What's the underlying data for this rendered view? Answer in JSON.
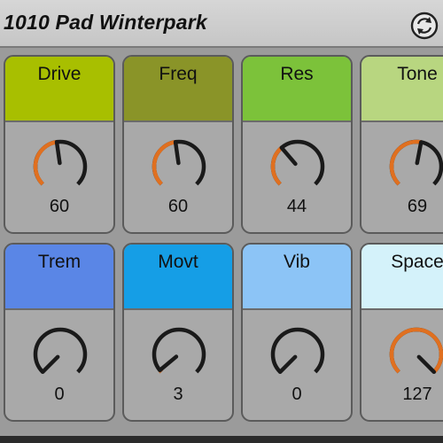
{
  "device": {
    "title": "1010 Pad Winterpark",
    "icon": "hot-swap-icon"
  },
  "macros": [
    {
      "label": "Drive",
      "value": "60",
      "level": 0.47,
      "color": "#a8bf00"
    },
    {
      "label": "Freq",
      "value": "60",
      "level": 0.47,
      "color": "#8a9428"
    },
    {
      "label": "Res",
      "value": "44",
      "level": 0.35,
      "color": "#7cc23a"
    },
    {
      "label": "Tone",
      "value": "69",
      "level": 0.54,
      "color": "#b8d680"
    },
    {
      "label": "Trem",
      "value": "0",
      "level": 0.0,
      "color": "#5a86e6"
    },
    {
      "label": "Movt",
      "value": "3",
      "level": 0.02,
      "color": "#159ee6"
    },
    {
      "label": "Vib",
      "value": "0",
      "level": 0.0,
      "color": "#8cc4f6"
    },
    {
      "label": "Space",
      "value": "127",
      "level": 1.0,
      "color": "#d4f2fa"
    }
  ],
  "colors": {
    "knob_track": "#1a1a1a",
    "knob_arc": "#e07020",
    "panel": "#9b9b9b"
  }
}
